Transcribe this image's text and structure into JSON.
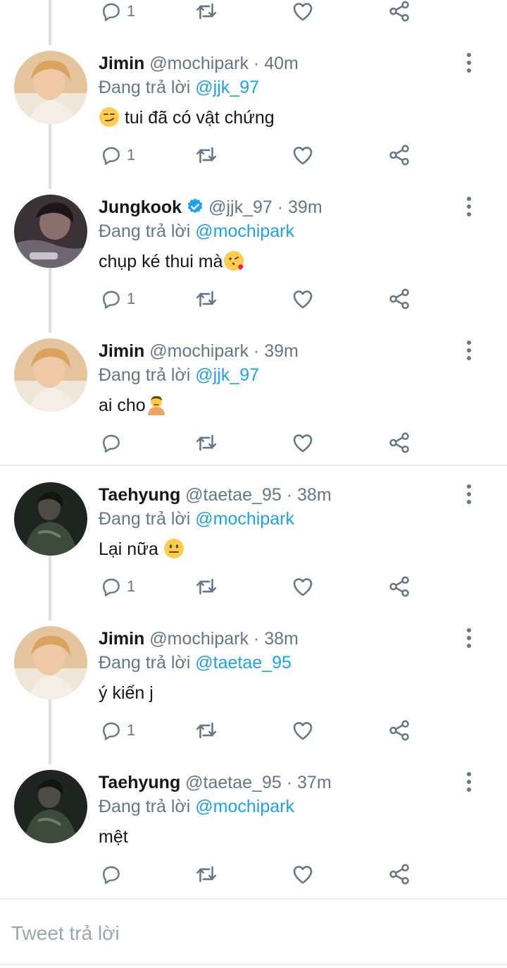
{
  "colors": {
    "accent": "#1da1f2",
    "muted": "#657786",
    "text": "#14171a",
    "verified": "#1da1f2"
  },
  "top_actions": {
    "reply_count": "1"
  },
  "tweets": [
    {
      "name": "Jimin",
      "handle": "@mochipark",
      "time": "40m",
      "reply_prefix": "Đang trả lời",
      "reply_to": "@jjk_97",
      "text": "tui đã có vật chứng",
      "emoji": "smirk-emoji",
      "reply_count": "1",
      "verified": false
    },
    {
      "name": "Jungkook",
      "handle": "@jjk_97",
      "time": "39m",
      "reply_prefix": "Đang trả lời",
      "reply_to": "@mochipark",
      "text": "chụp ké thui mà",
      "emoji": "kiss-emoji",
      "reply_count": "1",
      "verified": true
    },
    {
      "name": "Jimin",
      "handle": "@mochipark",
      "time": "39m",
      "reply_prefix": "Đang trả lời",
      "reply_to": "@jjk_97",
      "text": "ai cho",
      "emoji": "pouting-person-emoji",
      "reply_count": "",
      "verified": false
    },
    {
      "name": "Taehyung",
      "handle": "@taetae_95",
      "time": "38m",
      "reply_prefix": "Đang trả lời",
      "reply_to": "@mochipark",
      "text": "Lại nữa",
      "emoji": "neutral-face-emoji",
      "reply_count": "1",
      "verified": false
    },
    {
      "name": "Jimin",
      "handle": "@mochipark",
      "time": "38m",
      "reply_prefix": "Đang trả lời",
      "reply_to": "@taetae_95",
      "text": "ý kiến j",
      "emoji": "",
      "reply_count": "1",
      "verified": false
    },
    {
      "name": "Taehyung",
      "handle": "@taetae_95",
      "time": "37m",
      "reply_prefix": "Đang trả lời",
      "reply_to": "@mochipark",
      "text": "mệt",
      "emoji": "",
      "reply_count": "",
      "verified": false
    }
  ],
  "separator": "·",
  "reply_box": {
    "placeholder": "Tweet trả lời"
  }
}
